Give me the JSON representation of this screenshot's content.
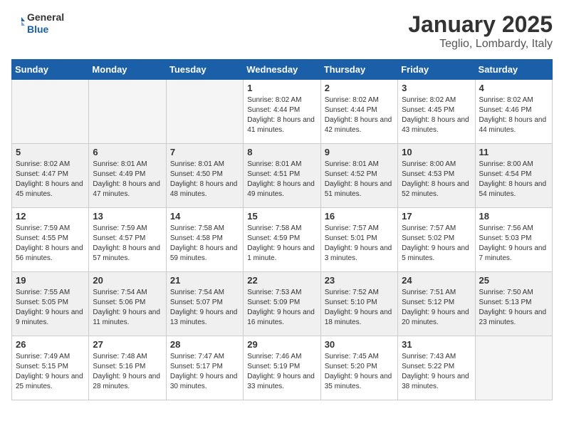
{
  "header": {
    "logo_general": "General",
    "logo_blue": "Blue",
    "month": "January 2025",
    "location": "Teglio, Lombardy, Italy"
  },
  "days_of_week": [
    "Sunday",
    "Monday",
    "Tuesday",
    "Wednesday",
    "Thursday",
    "Friday",
    "Saturday"
  ],
  "weeks": [
    {
      "shaded": false,
      "days": [
        {
          "num": "",
          "empty": true,
          "text": ""
        },
        {
          "num": "",
          "empty": true,
          "text": ""
        },
        {
          "num": "",
          "empty": true,
          "text": ""
        },
        {
          "num": "1",
          "empty": false,
          "text": "Sunrise: 8:02 AM\nSunset: 4:44 PM\nDaylight: 8 hours and 41 minutes."
        },
        {
          "num": "2",
          "empty": false,
          "text": "Sunrise: 8:02 AM\nSunset: 4:44 PM\nDaylight: 8 hours and 42 minutes."
        },
        {
          "num": "3",
          "empty": false,
          "text": "Sunrise: 8:02 AM\nSunset: 4:45 PM\nDaylight: 8 hours and 43 minutes."
        },
        {
          "num": "4",
          "empty": false,
          "text": "Sunrise: 8:02 AM\nSunset: 4:46 PM\nDaylight: 8 hours and 44 minutes."
        }
      ]
    },
    {
      "shaded": true,
      "days": [
        {
          "num": "5",
          "empty": false,
          "text": "Sunrise: 8:02 AM\nSunset: 4:47 PM\nDaylight: 8 hours and 45 minutes."
        },
        {
          "num": "6",
          "empty": false,
          "text": "Sunrise: 8:01 AM\nSunset: 4:49 PM\nDaylight: 8 hours and 47 minutes."
        },
        {
          "num": "7",
          "empty": false,
          "text": "Sunrise: 8:01 AM\nSunset: 4:50 PM\nDaylight: 8 hours and 48 minutes."
        },
        {
          "num": "8",
          "empty": false,
          "text": "Sunrise: 8:01 AM\nSunset: 4:51 PM\nDaylight: 8 hours and 49 minutes."
        },
        {
          "num": "9",
          "empty": false,
          "text": "Sunrise: 8:01 AM\nSunset: 4:52 PM\nDaylight: 8 hours and 51 minutes."
        },
        {
          "num": "10",
          "empty": false,
          "text": "Sunrise: 8:00 AM\nSunset: 4:53 PM\nDaylight: 8 hours and 52 minutes."
        },
        {
          "num": "11",
          "empty": false,
          "text": "Sunrise: 8:00 AM\nSunset: 4:54 PM\nDaylight: 8 hours and 54 minutes."
        }
      ]
    },
    {
      "shaded": false,
      "days": [
        {
          "num": "12",
          "empty": false,
          "text": "Sunrise: 7:59 AM\nSunset: 4:55 PM\nDaylight: 8 hours and 56 minutes."
        },
        {
          "num": "13",
          "empty": false,
          "text": "Sunrise: 7:59 AM\nSunset: 4:57 PM\nDaylight: 8 hours and 57 minutes."
        },
        {
          "num": "14",
          "empty": false,
          "text": "Sunrise: 7:58 AM\nSunset: 4:58 PM\nDaylight: 8 hours and 59 minutes."
        },
        {
          "num": "15",
          "empty": false,
          "text": "Sunrise: 7:58 AM\nSunset: 4:59 PM\nDaylight: 9 hours and 1 minute."
        },
        {
          "num": "16",
          "empty": false,
          "text": "Sunrise: 7:57 AM\nSunset: 5:01 PM\nDaylight: 9 hours and 3 minutes."
        },
        {
          "num": "17",
          "empty": false,
          "text": "Sunrise: 7:57 AM\nSunset: 5:02 PM\nDaylight: 9 hours and 5 minutes."
        },
        {
          "num": "18",
          "empty": false,
          "text": "Sunrise: 7:56 AM\nSunset: 5:03 PM\nDaylight: 9 hours and 7 minutes."
        }
      ]
    },
    {
      "shaded": true,
      "days": [
        {
          "num": "19",
          "empty": false,
          "text": "Sunrise: 7:55 AM\nSunset: 5:05 PM\nDaylight: 9 hours and 9 minutes."
        },
        {
          "num": "20",
          "empty": false,
          "text": "Sunrise: 7:54 AM\nSunset: 5:06 PM\nDaylight: 9 hours and 11 minutes."
        },
        {
          "num": "21",
          "empty": false,
          "text": "Sunrise: 7:54 AM\nSunset: 5:07 PM\nDaylight: 9 hours and 13 minutes."
        },
        {
          "num": "22",
          "empty": false,
          "text": "Sunrise: 7:53 AM\nSunset: 5:09 PM\nDaylight: 9 hours and 16 minutes."
        },
        {
          "num": "23",
          "empty": false,
          "text": "Sunrise: 7:52 AM\nSunset: 5:10 PM\nDaylight: 9 hours and 18 minutes."
        },
        {
          "num": "24",
          "empty": false,
          "text": "Sunrise: 7:51 AM\nSunset: 5:12 PM\nDaylight: 9 hours and 20 minutes."
        },
        {
          "num": "25",
          "empty": false,
          "text": "Sunrise: 7:50 AM\nSunset: 5:13 PM\nDaylight: 9 hours and 23 minutes."
        }
      ]
    },
    {
      "shaded": false,
      "days": [
        {
          "num": "26",
          "empty": false,
          "text": "Sunrise: 7:49 AM\nSunset: 5:15 PM\nDaylight: 9 hours and 25 minutes."
        },
        {
          "num": "27",
          "empty": false,
          "text": "Sunrise: 7:48 AM\nSunset: 5:16 PM\nDaylight: 9 hours and 28 minutes."
        },
        {
          "num": "28",
          "empty": false,
          "text": "Sunrise: 7:47 AM\nSunset: 5:17 PM\nDaylight: 9 hours and 30 minutes."
        },
        {
          "num": "29",
          "empty": false,
          "text": "Sunrise: 7:46 AM\nSunset: 5:19 PM\nDaylight: 9 hours and 33 minutes."
        },
        {
          "num": "30",
          "empty": false,
          "text": "Sunrise: 7:45 AM\nSunset: 5:20 PM\nDaylight: 9 hours and 35 minutes."
        },
        {
          "num": "31",
          "empty": false,
          "text": "Sunrise: 7:43 AM\nSunset: 5:22 PM\nDaylight: 9 hours and 38 minutes."
        },
        {
          "num": "",
          "empty": true,
          "text": ""
        }
      ]
    }
  ]
}
